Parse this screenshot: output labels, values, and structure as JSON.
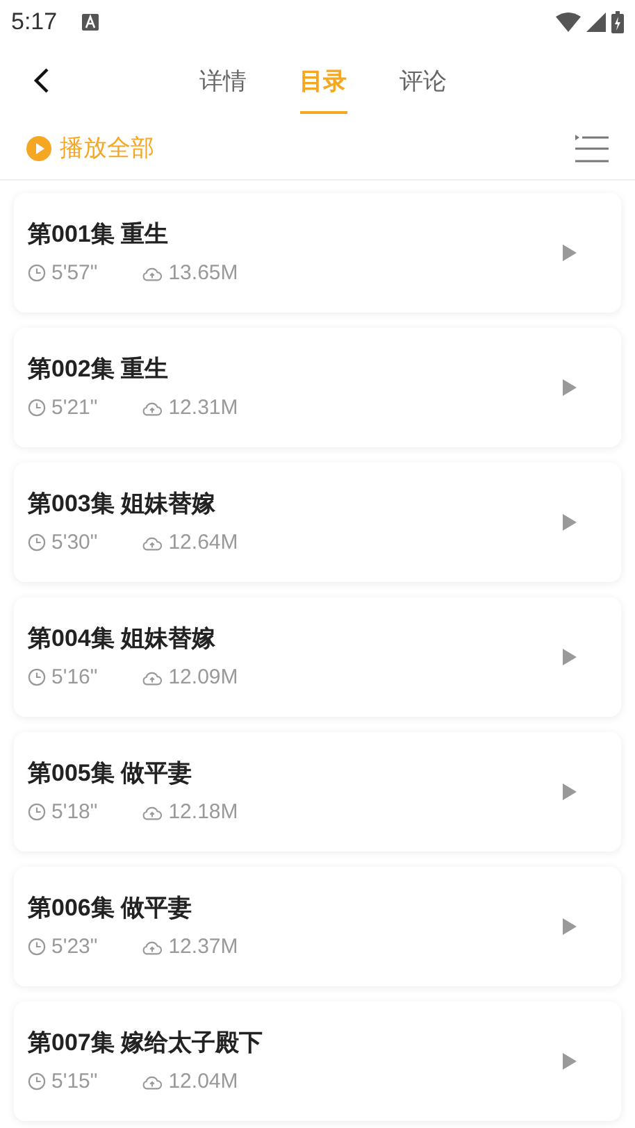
{
  "status_bar": {
    "time": "5:17"
  },
  "tabs": [
    {
      "label": "详情",
      "selected": false
    },
    {
      "label": "目录",
      "selected": true
    },
    {
      "label": "评论",
      "selected": false
    }
  ],
  "play_all": {
    "label": "播放全部"
  },
  "episodes": [
    {
      "title": "第001集 重生",
      "duration": "5'57\"",
      "size": "13.65M"
    },
    {
      "title": "第002集 重生",
      "duration": "5'21\"",
      "size": "12.31M"
    },
    {
      "title": "第003集 姐妹替嫁",
      "duration": "5'30\"",
      "size": "12.64M"
    },
    {
      "title": "第004集 姐妹替嫁",
      "duration": "5'16\"",
      "size": "12.09M"
    },
    {
      "title": "第005集 做平妻",
      "duration": "5'18\"",
      "size": "12.18M"
    },
    {
      "title": "第006集 做平妻",
      "duration": "5'23\"",
      "size": "12.37M"
    },
    {
      "title": "第007集 嫁给太子殿下",
      "duration": "5'15\"",
      "size": "12.04M"
    }
  ]
}
